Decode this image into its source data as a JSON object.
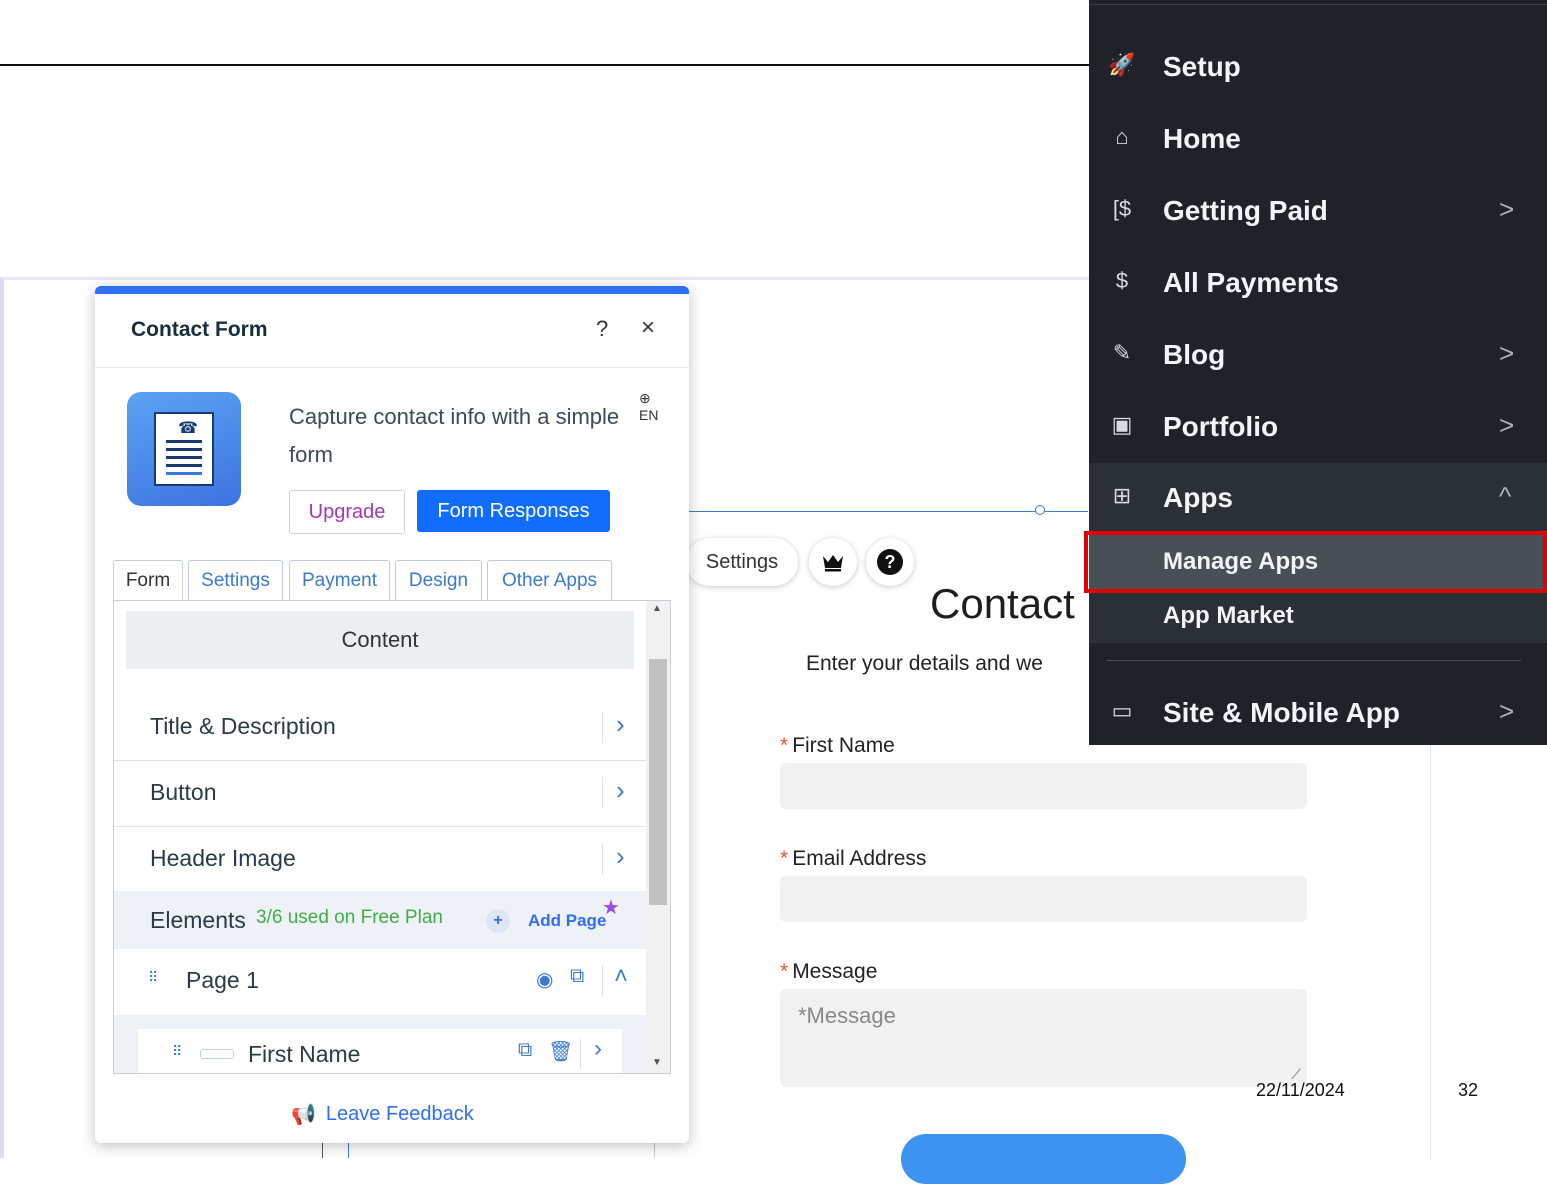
{
  "nav_menu": {
    "items": [
      {
        "label": "Setup",
        "icon": "rocket-icon",
        "glyph": "🚀",
        "chevron": ""
      },
      {
        "label": "Home",
        "icon": "home-icon",
        "glyph": "⌂",
        "chevron": ""
      },
      {
        "label": "Getting Paid",
        "icon": "invoice-icon",
        "glyph": "[$",
        "chevron": ">"
      },
      {
        "label": "All Payments",
        "icon": "dollar-circle-icon",
        "glyph": "$",
        "chevron": ""
      },
      {
        "label": "Blog",
        "icon": "pen-nib-icon",
        "glyph": "✎",
        "chevron": ">"
      },
      {
        "label": "Portfolio",
        "icon": "portfolio-icon",
        "glyph": "▣",
        "chevron": ">"
      },
      {
        "label": "Apps",
        "icon": "apps-icon",
        "glyph": "⊞",
        "chevron": "^"
      }
    ],
    "sub_items": [
      {
        "label": "Manage Apps"
      },
      {
        "label": "App Market"
      }
    ],
    "bottom_item": {
      "label": "Site & Mobile App",
      "icon": "devices-icon",
      "glyph": "▭",
      "chevron": ">"
    }
  },
  "panel": {
    "title": "Contact Form",
    "help": "?",
    "close": "×",
    "description": "Capture contact info with a simple form",
    "language": "EN",
    "upgrade_label": "Upgrade",
    "responses_label": "Form Responses",
    "tabs": [
      "Form",
      "Settings",
      "Payment",
      "Design",
      "Other Apps"
    ],
    "content_heading": "Content",
    "rows": [
      "Title & Description",
      "Button",
      "Header Image"
    ],
    "elements_label": "Elements",
    "elements_usage": "3/6 used on Free Plan",
    "add_page_label": "Add Page",
    "page_label": "Page 1",
    "field_label": "First Name",
    "feedback_label": "Leave Feedback"
  },
  "toolbar": {
    "settings_label": "Settings",
    "help": "?"
  },
  "site_form": {
    "title": "Contact",
    "subtitle": "Enter your details and we",
    "fields": [
      {
        "label": "First Name",
        "required": "*"
      },
      {
        "label": "Email Address",
        "required": "*"
      },
      {
        "label": "Message",
        "required": "*"
      }
    ],
    "message_placeholder": "*Message"
  },
  "slide": {
    "date": "22/11/2024",
    "number": "32"
  },
  "colors": {
    "accent": "#116dff",
    "menu_bg": "#1f2329",
    "highlight": "#e00000",
    "upgrade": "#a637b3"
  }
}
